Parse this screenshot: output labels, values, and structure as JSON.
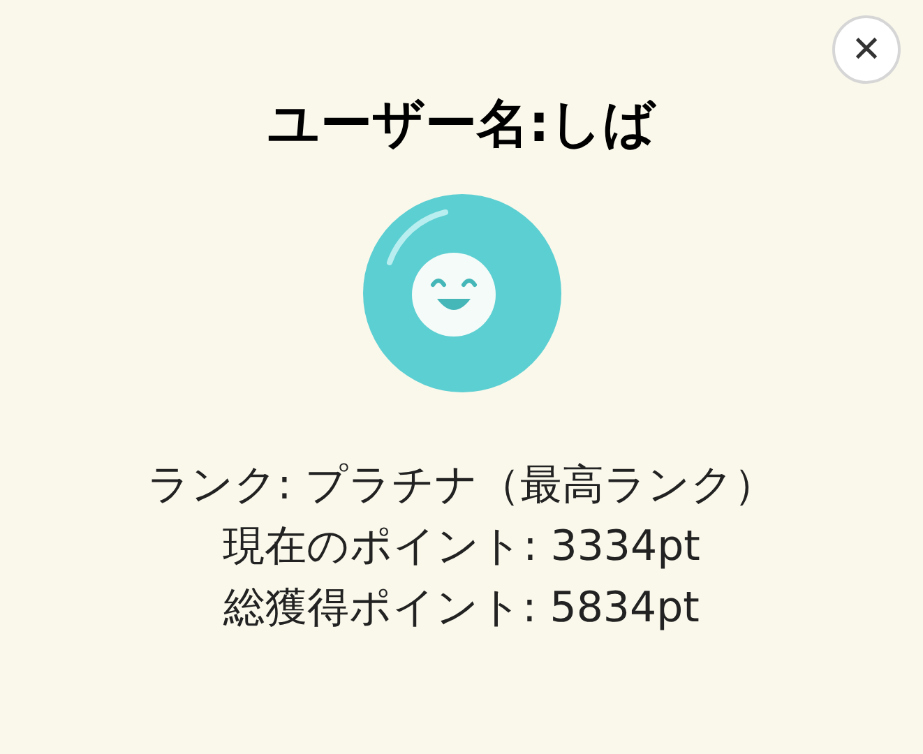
{
  "close_button": {
    "label": "✕"
  },
  "title": "ユーザー名:しば",
  "info_lines": [
    "ランク: プラチナ（最高ランク）",
    "現在のポイント: 3334pt",
    "総獲得ポイント: 5834pt"
  ]
}
